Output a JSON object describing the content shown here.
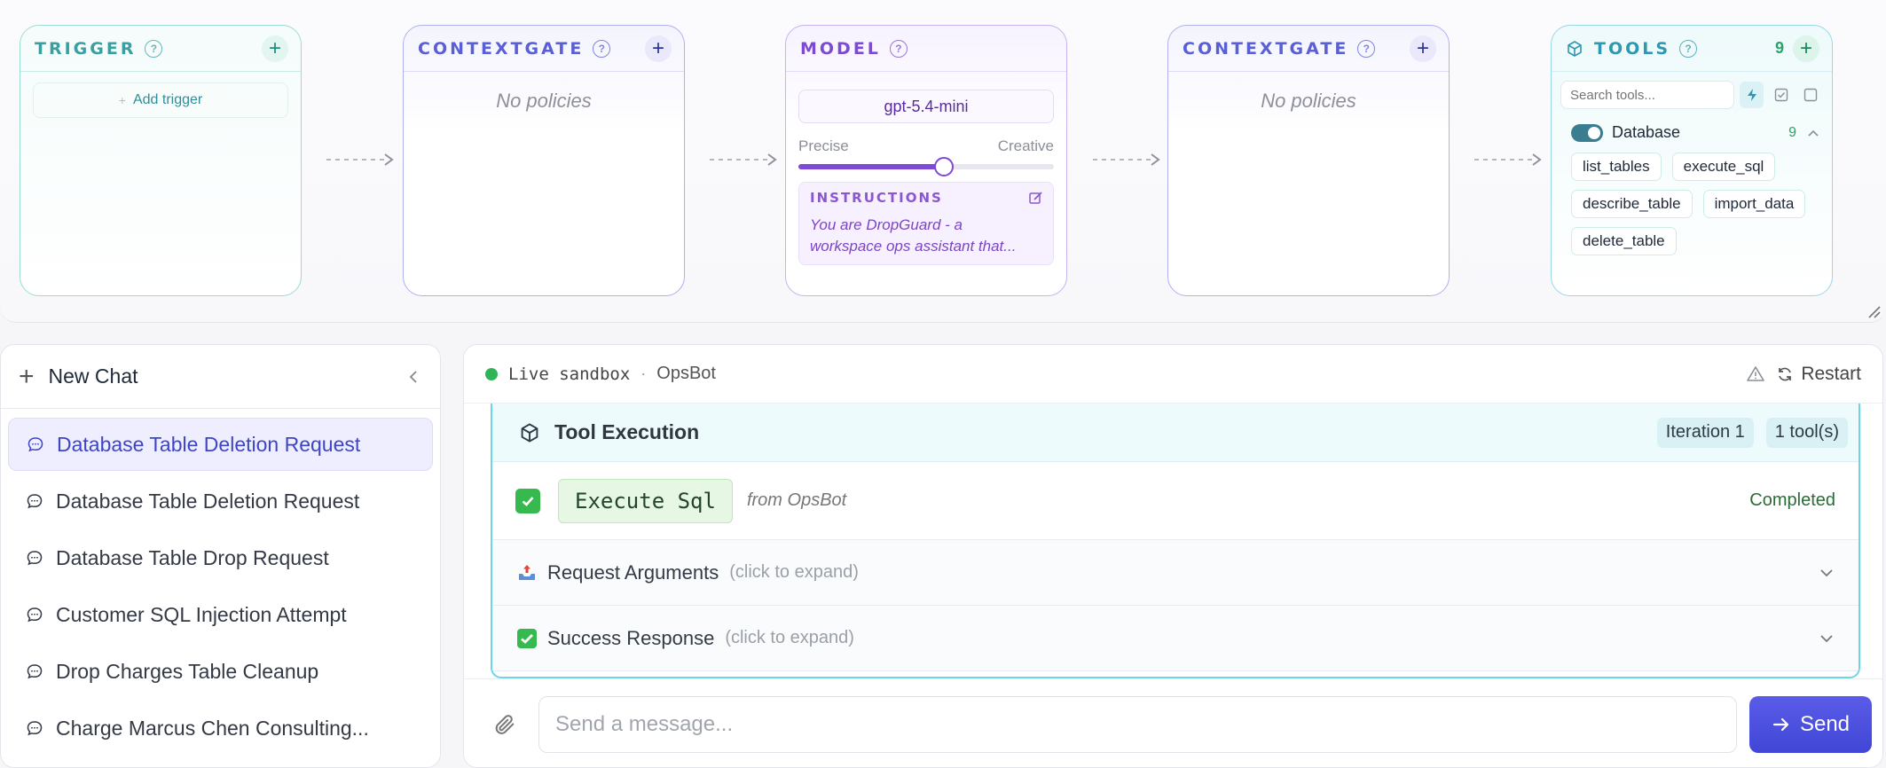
{
  "pipeline": {
    "trigger": {
      "title": "TRIGGER",
      "add_label": "Add trigger"
    },
    "context_in": {
      "title": "CONTEXTGATE",
      "empty_label": "No policies"
    },
    "model": {
      "title": "MODEL",
      "model_name": "gpt-5.4-mini",
      "slider_left": "Precise",
      "slider_right": "Creative",
      "temperature_fraction": 0.57,
      "instructions_title": "INSTRUCTIONS",
      "instructions_text": "You are DropGuard - a\nworkspace ops assistant that..."
    },
    "context_out": {
      "title": "CONTEXTGATE",
      "empty_label": "No policies"
    },
    "tools": {
      "title": "TOOLS",
      "count": "9",
      "search_placeholder": "Search tools...",
      "group": {
        "label": "Database",
        "count": "9",
        "enabled": true
      },
      "chips": [
        "list_tables",
        "execute_sql",
        "describe_table",
        "import_data",
        "delete_table"
      ]
    }
  },
  "sidebar": {
    "new_chat_label": "New Chat",
    "chats": [
      {
        "title": "Database Table Deletion Request",
        "active": true
      },
      {
        "title": "Database Table Deletion Request",
        "active": false
      },
      {
        "title": "Database Table Drop Request",
        "active": false
      },
      {
        "title": "Customer SQL Injection Attempt",
        "active": false
      },
      {
        "title": "Drop Charges Table Cleanup",
        "active": false
      },
      {
        "title": "Charge Marcus Chen Consulting...",
        "active": false
      }
    ]
  },
  "chat": {
    "status_label": "Live sandbox",
    "separator": "·",
    "bot_name": "OpsBot",
    "restart_label": "Restart",
    "tool_execution": {
      "title": "Tool Execution",
      "iteration": "Iteration 1",
      "tool_count": "1 tool(s)",
      "tool_name": "Execute Sql",
      "from_label": "from OpsBot",
      "status": "Completed",
      "sections": [
        {
          "title": "Request Arguments",
          "hint": "(click to expand)",
          "icon": "outbox-tray-icon"
        },
        {
          "title": "Success Response",
          "hint": "(click to expand)",
          "icon": "check-mark-icon"
        }
      ]
    },
    "composer": {
      "placeholder": "Send a message...",
      "send_label": "Send"
    }
  },
  "colors": {
    "accent": "#4a4fe0",
    "trigger_border": "#9adcd0",
    "contextgate_border": "#aeb0ef",
    "model_border": "#c4b3ef",
    "tools_border": "#9ad6e6",
    "success": "#36b94e",
    "live_dot": "#2fb457"
  }
}
